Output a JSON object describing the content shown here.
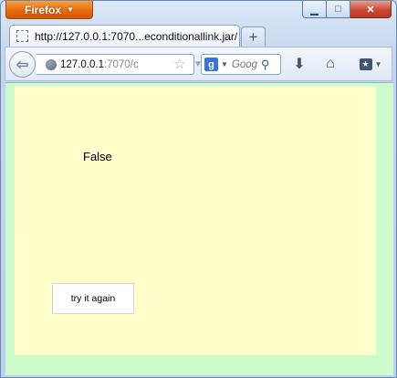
{
  "app": {
    "menu_label": "Firefox",
    "caption_buttons": {
      "minimize": "▁",
      "maximize": "□",
      "close": "✕"
    }
  },
  "tab": {
    "title": "http://127.0.0.1:7070...econditionallink.jar/",
    "new_tab_label": "+"
  },
  "navbar": {
    "url_host": "127.0.0.1",
    "url_path": ":7070/c",
    "search_placeholder": "Goog",
    "search_engine_icon": "g-icon"
  },
  "page": {
    "result_text": "False",
    "button_label": "try it again",
    "colors": {
      "outer_background": "#ccfccc",
      "panel_background": "#ffffcc"
    }
  }
}
